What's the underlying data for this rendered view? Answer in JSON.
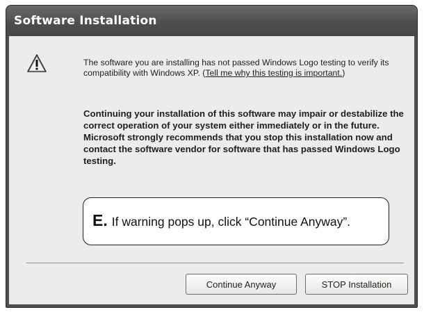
{
  "window": {
    "title": "Software Installation"
  },
  "icons": {
    "warning": "warning-icon"
  },
  "message": {
    "intro": "The software you are installing has not passed Windows Logo testing to verify its compatibility with Windows XP. (",
    "link_text": "Tell me why this testing is important.",
    "close_paren": ")",
    "warning": "Continuing your installation of this software may impair or destabilize the correct operation of your system either immediately or in the future. Microsoft strongly recommends that you stop this installation now and contact the software vendor for software that has passed Windows Logo testing."
  },
  "callout": {
    "letter": "E.",
    "text": "If warning pops up, click “Continue Anyway”."
  },
  "buttons": {
    "continue": "Continue Anyway",
    "stop": "STOP Installation"
  }
}
